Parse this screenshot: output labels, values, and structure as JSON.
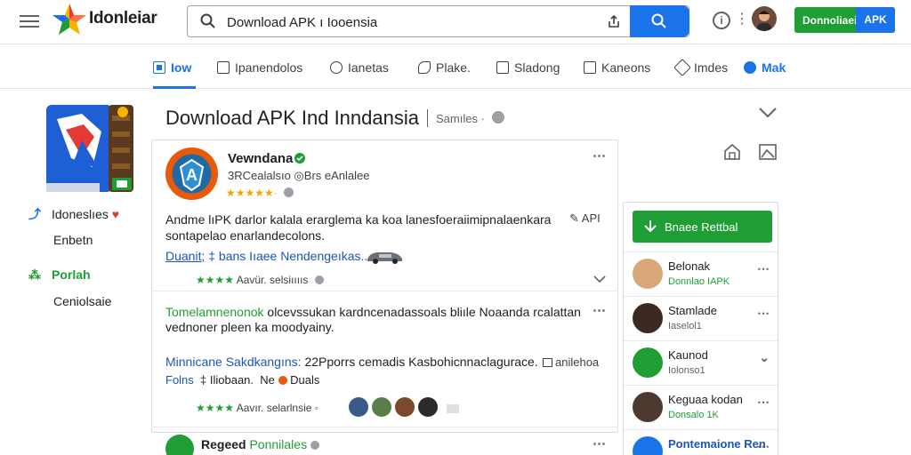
{
  "header": {
    "brand": "Idonleiar",
    "search_value": "Download APK ı Iooensia",
    "download_label": "Donnoliaei",
    "apk_label": "APK"
  },
  "tabs": [
    {
      "label": "Iow"
    },
    {
      "label": "Ipanendolos"
    },
    {
      "label": "Ianetas"
    },
    {
      "label": "Plake."
    },
    {
      "label": "Sladong"
    },
    {
      "label": "Kaneons"
    },
    {
      "label": "Imdes"
    },
    {
      "label": "Mak"
    }
  ],
  "sidebar": {
    "items": [
      {
        "label": "Idoneslıes"
      },
      {
        "label": "Enbetn"
      },
      {
        "label": "Porlah"
      },
      {
        "label": "Ceniolsaie"
      }
    ],
    "heart": "♥"
  },
  "main": {
    "title": "Download APK Ind Inndansia",
    "subtitle": "Samıles ·"
  },
  "card": {
    "name": "Vewndana",
    "meta": "3RCealalsıo  ◎Brs eAnlalee",
    "stars": "★★★★★·",
    "para1_line1": "Andme lıPK darlor kalala erarglema ka koa lanesfoeraiimipnalaenkara",
    "para1_line2": "sontapelao enarlandecolons.",
    "api_tag": "API",
    "link1_a": "Duanit;",
    "link1_b": "‡  bans Iıaee Nendengeıkas...",
    "rating1_stars": "★★★★",
    "rating1_text": "Aavür. selsiııııs",
    "para2_green": "Tomelamnenonok",
    "para2_rest": "olcevssukan kardncenadassoals bliıle Noaanda rcalattan",
    "para2_line2": "vednoner pleen ka moodyainy.",
    "para3_blue": "Minnicane Sakdkangıns:",
    "para3_rest": "22Pporrs cemadis Kasbohicnnaclagurace.",
    "para3_tag": "anilehoa",
    "row_a": "Folns",
    "row_b": "‡ Iliobaan.",
    "row_c": "Ne",
    "row_d": "Duals",
    "rating2_stars": "★★★★",
    "rating2_text": "Aavır. selarlnsie  ◦",
    "last_name_a": "Regeed",
    "last_name_b": "Ponnilales"
  },
  "right": {
    "button_label": "Bnaee Rettbal",
    "rows": [
      {
        "name": "Belonak",
        "sub": "Donnlao IAPK"
      },
      {
        "name": "Stamlade",
        "sub": "Iaselol1"
      },
      {
        "name": "Kaunod",
        "sub": "Iolonso1"
      },
      {
        "name": "Keguaa kodan",
        "sub": "Donsalo 1K"
      },
      {
        "name": "Pontemaione Ren",
        "sub": ""
      }
    ]
  },
  "colors": {
    "accent_blue": "#1a73e8",
    "accent_green": "#1e9e35",
    "logo_orange": "#e8590c"
  }
}
